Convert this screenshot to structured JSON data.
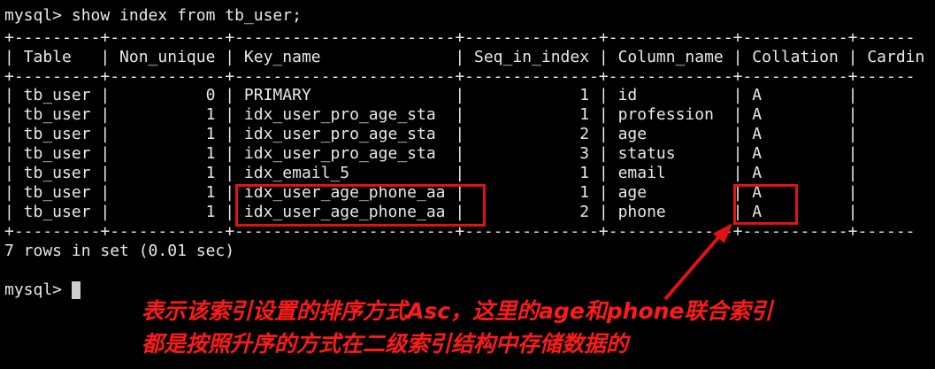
{
  "terminal": {
    "command_line": "mysql> show index from tb_user;",
    "border_top": "+---------+------------+-----------------------+--------------+-------------+-----------+------",
    "header_row": "| Table   | Non_unique | Key_name              | Seq_in_index | Column_name | Collation | Cardin",
    "border_mid": "+---------+------------+-----------------------+--------------+-------------+-----------+------",
    "columns": [
      "Table",
      "Non_unique",
      "Key_name",
      "Seq_in_index",
      "Column_name",
      "Collation",
      "Cardin"
    ],
    "rows": [
      "| tb_user |          0 | PRIMARY               |            1 | id          | A         |",
      "| tb_user |          1 | idx_user_pro_age_sta  |            1 | profession  | A         |",
      "| tb_user |          1 | idx_user_pro_age_sta  |            2 | age         | A         |",
      "| tb_user |          1 | idx_user_pro_age_sta  |            3 | status      | A         |",
      "| tb_user |          1 | idx_email_5           |            1 | email       | A         |",
      "| tb_user |          1 | idx_user_age_phone_aa |            1 | age         | A         |",
      "| tb_user |          1 | idx_user_age_phone_aa |            2 | phone       | A         |"
    ],
    "border_bottom": "+---------+------------+-----------------------+--------------+-------------+-----------+------",
    "result_summary": "7 rows in set (0.01 sec)",
    "prompt": "mysql> "
  },
  "annotation": {
    "line1": "表示该索引设置的排序方式Asc，这里的age和phone联合索引",
    "line2": "都是按照升序的方式在二级索引结构中存储数据的",
    "color": "#e01212"
  }
}
